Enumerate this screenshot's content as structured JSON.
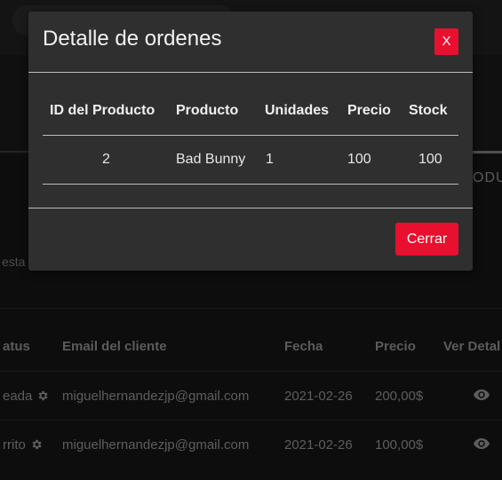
{
  "background_table": {
    "filter_text": "esta",
    "tab_partial": "ODU",
    "headers": [
      "atus",
      "Email del cliente",
      "Fecha",
      "Precio",
      "Ver Detal"
    ],
    "rows": [
      {
        "status": "eada",
        "email": "miguelhernandezjp@gmail.com",
        "date": "2021-02-26",
        "price": "200,00$"
      },
      {
        "status": "rrito",
        "email": "miguelhernandezjp@gmail.com",
        "date": "2021-02-26",
        "price": "100,00$"
      }
    ]
  },
  "modal": {
    "title": "Detalle de ordenes",
    "close_x_label": "X",
    "headers": [
      "ID del Producto",
      "Producto",
      "Unidades",
      "Precio",
      "Stock"
    ],
    "rows": [
      {
        "id": "2",
        "product": "Bad Bunny",
        "units": "1",
        "price": "100",
        "stock": "100"
      }
    ],
    "close_button_label": "Cerrar"
  },
  "colors": {
    "accent": "#e8102e",
    "modal_bg": "#2f2f2f",
    "page_bg": "#141414"
  }
}
